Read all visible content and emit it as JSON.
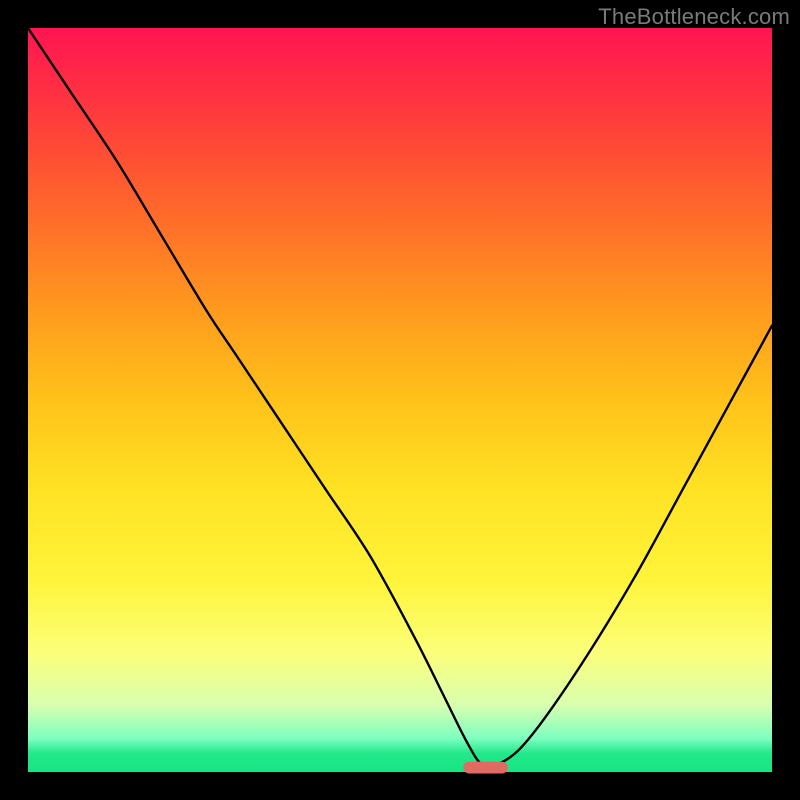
{
  "watermark": {
    "text": "TheBottleneck.com"
  },
  "colors": {
    "background": "#000000",
    "curve": "#000000",
    "marker": "#e26a63",
    "gradient_top": "#ff1452",
    "gradient_bottom": "#18e484"
  },
  "chart_data": {
    "type": "line",
    "title": "",
    "xlabel": "",
    "ylabel": "",
    "xlim": [
      0,
      100
    ],
    "ylim": [
      0,
      100
    ],
    "grid": false,
    "legend": false,
    "series": [
      {
        "name": "bottleneck-curve",
        "x": [
          0,
          6,
          12,
          18,
          24,
          28,
          34,
          40,
          46,
          52,
          56,
          59,
          61,
          63,
          66,
          70,
          76,
          82,
          88,
          94,
          100
        ],
        "values": [
          100,
          91,
          82,
          72,
          62,
          56,
          47,
          38,
          29,
          18,
          10,
          4,
          1,
          1,
          3,
          8,
          17,
          27,
          38,
          49,
          60
        ]
      }
    ],
    "annotations": [
      {
        "name": "optimal-marker",
        "shape": "capsule",
        "x_center": 61.5,
        "y": 0.6,
        "width": 6,
        "height": 1.6
      }
    ]
  }
}
